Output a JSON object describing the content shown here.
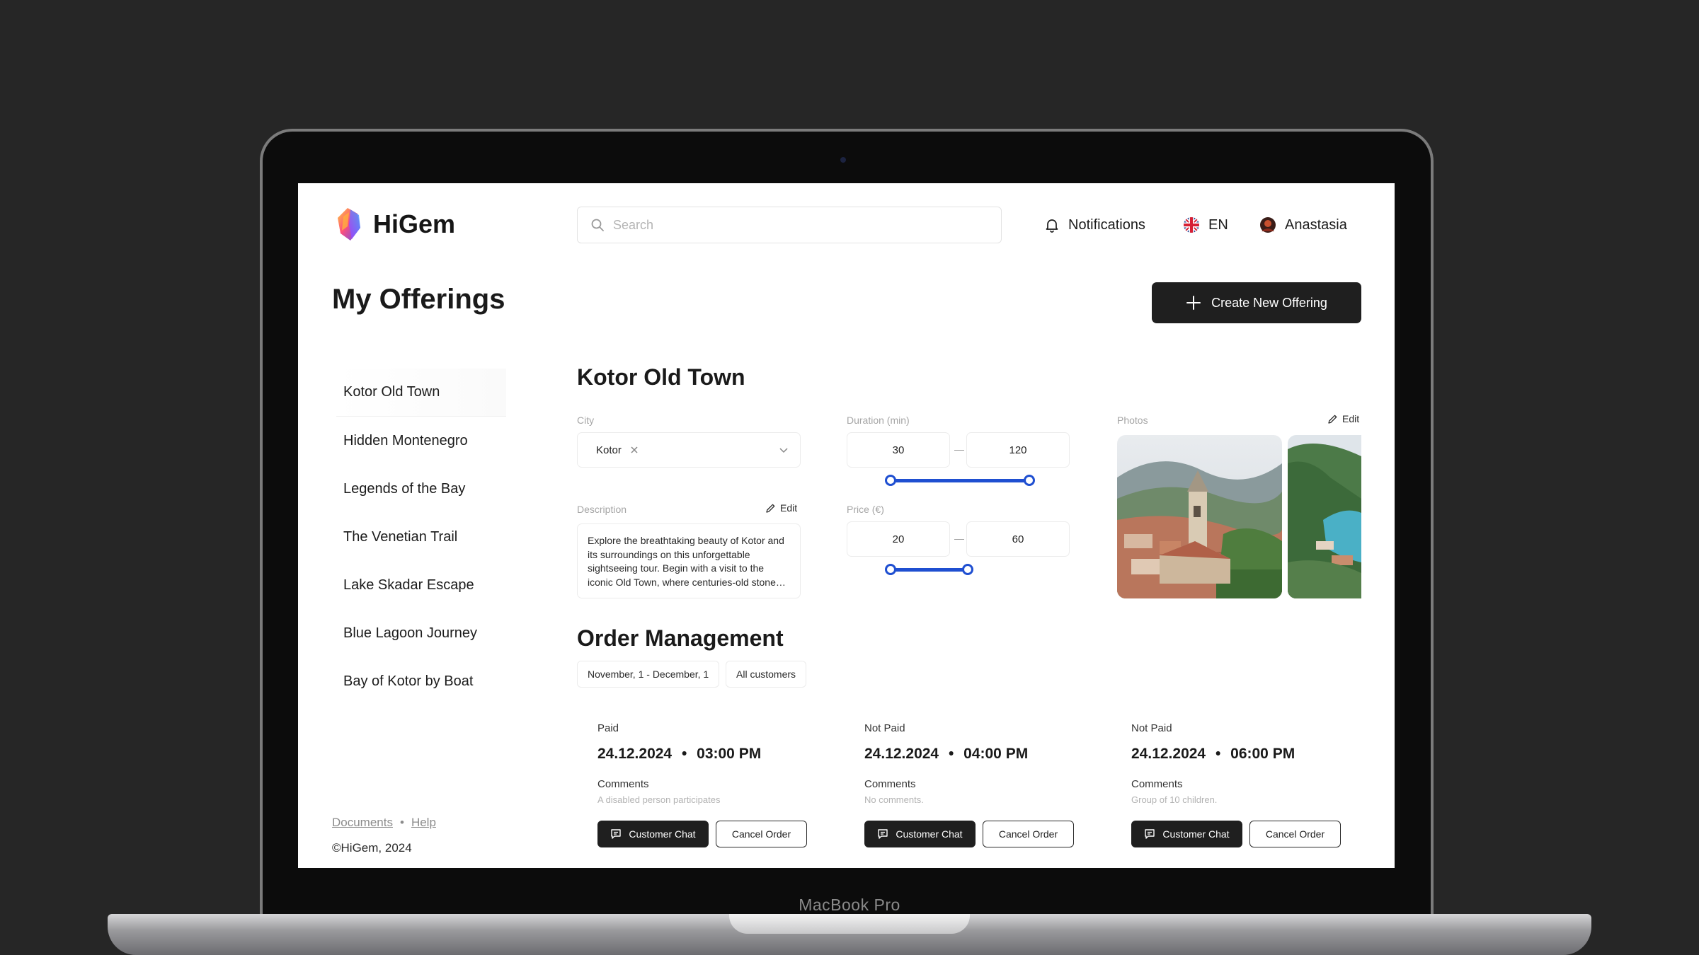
{
  "device": {
    "label": "MacBook Pro"
  },
  "brand": {
    "name": "HiGem"
  },
  "search": {
    "placeholder": "Search"
  },
  "topnav": {
    "notifications": "Notifications",
    "language": "EN",
    "user": "Anastasia"
  },
  "page": {
    "title": "My Offerings",
    "create_label": "Create New Offering"
  },
  "sidebar": {
    "items": [
      {
        "label": "Kotor Old Town"
      },
      {
        "label": "Hidden Montenegro"
      },
      {
        "label": "Legends of the Bay"
      },
      {
        "label": "The Venetian Trail"
      },
      {
        "label": "Lake Skadar Escape"
      },
      {
        "label": "Blue Lagoon Journey"
      },
      {
        "label": "Bay of Kotor by Boat"
      }
    ]
  },
  "footer": {
    "documents": "Documents",
    "separator": "•",
    "help": "Help",
    "copyright": "©HiGem, 2024"
  },
  "offering": {
    "title": "Kotor Old Town",
    "city_label": "City",
    "city_value": "Kotor",
    "description_label": "Description",
    "edit_label": "Edit",
    "description": "Explore the breathtaking beauty of Kotor and its surroundings on this unforgettable sightseeing tour. Begin with a visit to the iconic Old Town, where centuries-old stone…",
    "duration_label": "Duration (min)",
    "duration_min": "30",
    "duration_max": "120",
    "price_label": "Price (€)",
    "price_min": "20",
    "price_max": "60",
    "range_dash": "—",
    "photos_label": "Photos"
  },
  "orders": {
    "title": "Order Management",
    "date_filter": "November, 1 - December, 1",
    "customer_filter": "All customers",
    "comments_label": "Comments",
    "chat_label": "Customer Chat",
    "cancel_label": "Cancel Order",
    "bullet": "•",
    "items": [
      {
        "status": "Paid",
        "date": "24.12.2024",
        "time": "03:00 PM",
        "comment": "A disabled person participates"
      },
      {
        "status": "Not Paid",
        "date": "24.12.2024",
        "time": "04:00 PM",
        "comment": "No comments."
      },
      {
        "status": "Not Paid",
        "date": "24.12.2024",
        "time": "06:00 PM",
        "comment": "Group of 10 children."
      }
    ]
  },
  "colors": {
    "accent": "#1f4fd1",
    "dark_button": "#1f1f1f",
    "background": "#262626"
  }
}
